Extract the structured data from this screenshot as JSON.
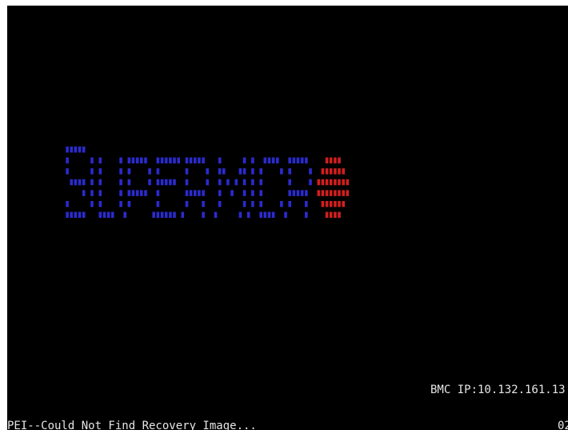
{
  "screen": {
    "background": "#000000",
    "logo": {
      "name": "supermicro-logo",
      "letter_color": "#2b2bcf",
      "dot_color": "#d21e1e"
    },
    "bmc_ip_text": "BMC IP:10.132.161.13",
    "status_text": "PEI--Could Not Find Recovery Image...",
    "post_code": "02",
    "text_color": "#e6e6e6"
  }
}
